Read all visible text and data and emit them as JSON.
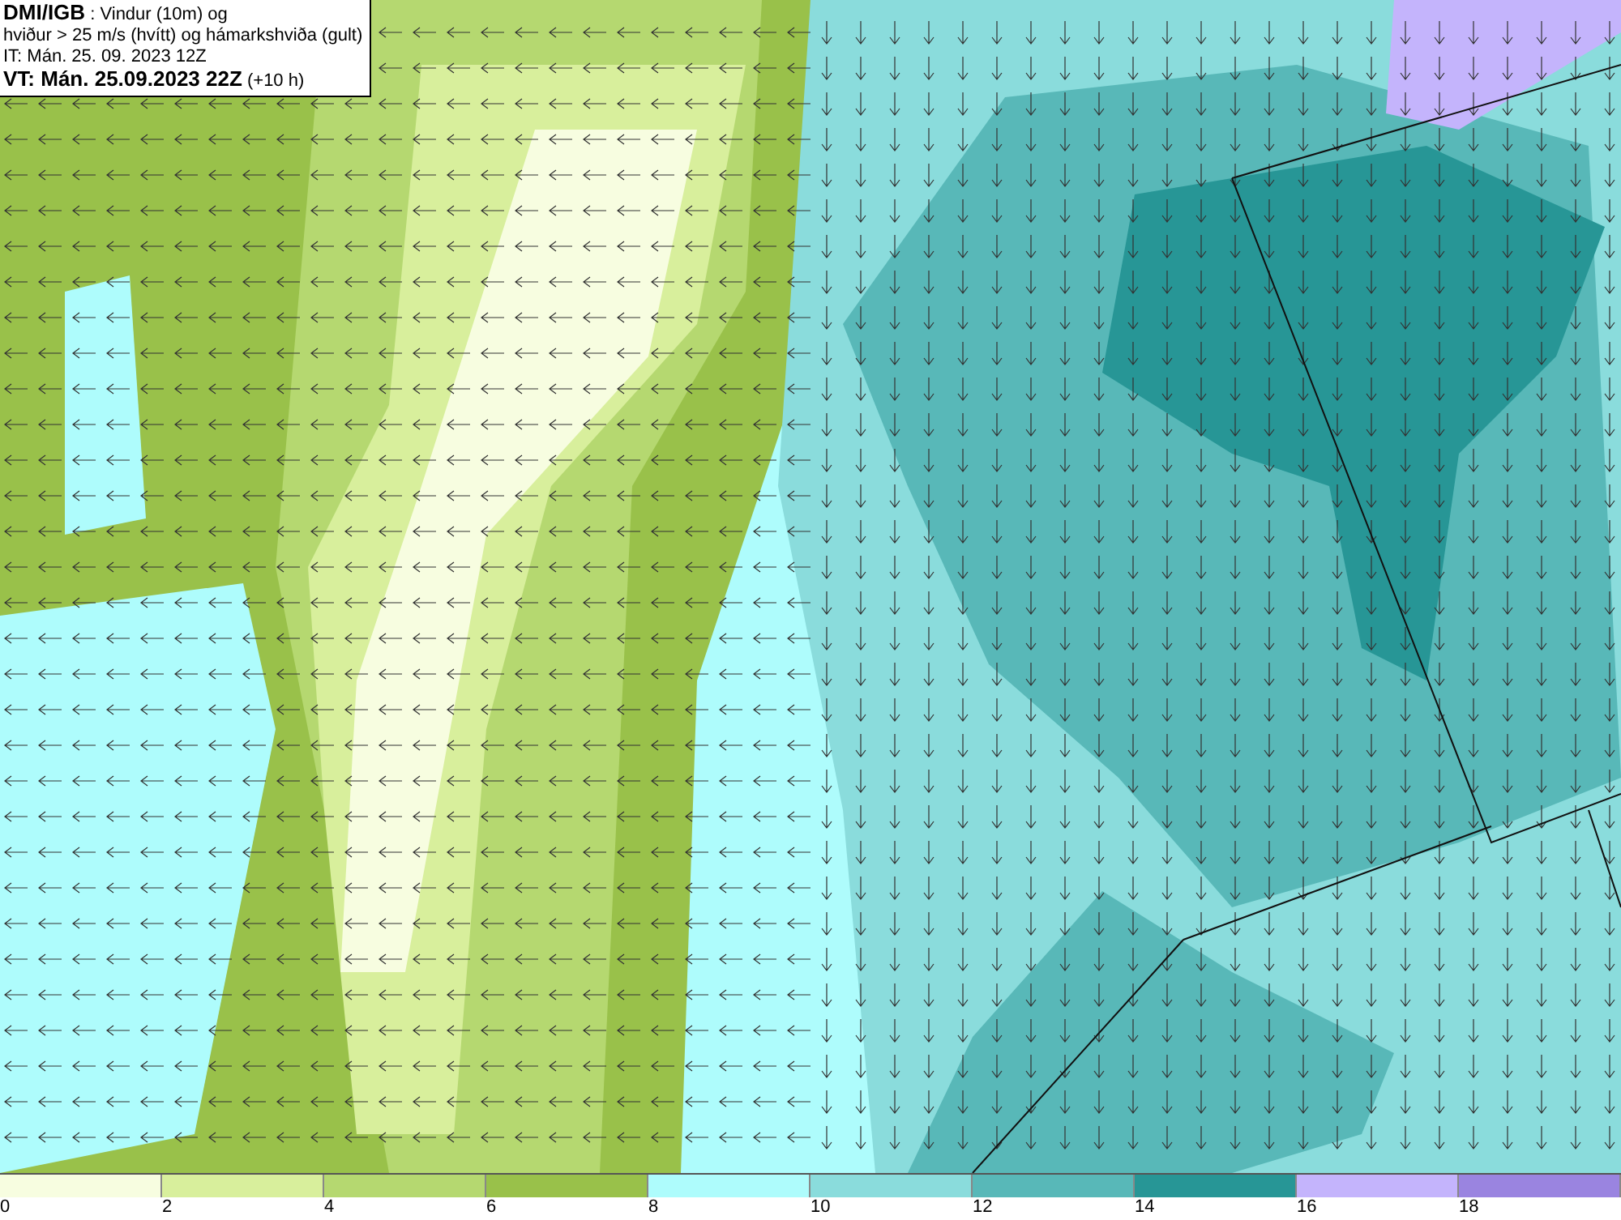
{
  "header": {
    "lines": [
      "**DMI/IGB** : Vindur (10m) og",
      "hviður > 25 m/s (hvítt) og hámarkshviða (gult)",
      "IT: Mán. 25. 09. 2023 12Z",
      "**VT: Mán. 25.09.2023 22Z** (+10 h)"
    ]
  },
  "legend": {
    "bins": [
      {
        "label": "0",
        "color": "#f7fde0"
      },
      {
        "label": "2",
        "color": "#d8ef9c"
      },
      {
        "label": "4",
        "color": "#b5d870"
      },
      {
        "label": "6",
        "color": "#99c14a"
      },
      {
        "label": "8",
        "color": "#aefcfc"
      },
      {
        "label": "10",
        "color": "#8adcdc"
      },
      {
        "label": "12",
        "color": "#58b8b8"
      },
      {
        "label": "14",
        "color": "#279696"
      },
      {
        "label": "16",
        "color": "#c4b4fc"
      },
      {
        "label": "18",
        "color": "#9a84e0"
      }
    ]
  }
}
